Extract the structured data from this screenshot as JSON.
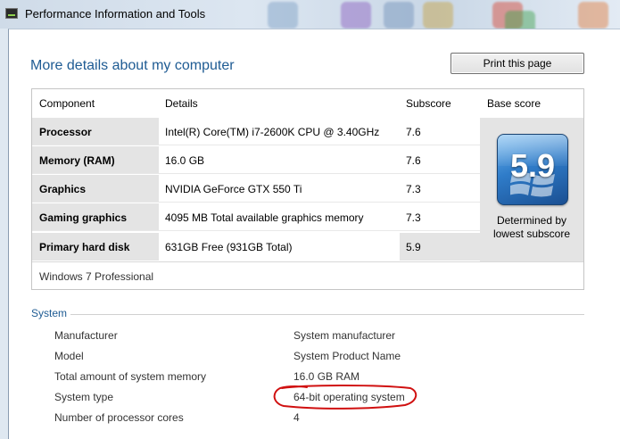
{
  "window": {
    "title": "Performance Information and Tools"
  },
  "page": {
    "heading": "More details about my computer",
    "print_button": "Print this page"
  },
  "score_table": {
    "headers": {
      "component": "Component",
      "details": "Details",
      "subscore": "Subscore",
      "base_score": "Base score"
    },
    "rows": [
      {
        "component": "Processor",
        "details": "Intel(R) Core(TM) i7-2600K CPU @ 3.40GHz",
        "subscore": "7.6",
        "lowest": false
      },
      {
        "component": "Memory (RAM)",
        "details": "16.0 GB",
        "subscore": "7.6",
        "lowest": false
      },
      {
        "component": "Graphics",
        "details": "NVIDIA GeForce GTX 550 Ti",
        "subscore": "7.3",
        "lowest": false
      },
      {
        "component": "Gaming graphics",
        "details": "4095 MB Total available graphics memory",
        "subscore": "7.3",
        "lowest": false
      },
      {
        "component": "Primary hard disk",
        "details": "631GB Free (931GB Total)",
        "subscore": "5.9",
        "lowest": true
      }
    ],
    "base_score": "5.9",
    "base_caption_line1": "Determined by",
    "base_caption_line2": "lowest subscore",
    "os_edition": "Windows 7 Professional"
  },
  "system": {
    "heading": "System",
    "rows": [
      {
        "key": "Manufacturer",
        "value": "System manufacturer"
      },
      {
        "key": "Model",
        "value": "System Product Name"
      },
      {
        "key": "Total amount of system memory",
        "value": "16.0 GB RAM"
      },
      {
        "key": "System type",
        "value": "64-bit operating system"
      },
      {
        "key": "Number of processor cores",
        "value": "4"
      }
    ]
  },
  "colors": {
    "heading_blue": "#1e5b93",
    "lowest_highlight": "#e4e4e4",
    "annotation_red": "#d01010"
  },
  "annotation": {
    "shape": "hand-drawn red ellipse",
    "target": "system.rows.3.value"
  }
}
